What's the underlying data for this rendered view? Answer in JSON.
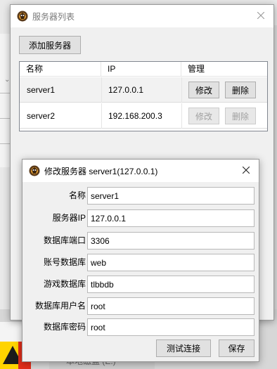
{
  "main_window": {
    "title": "服务器列表",
    "add_button": "添加服务器",
    "columns": [
      "名称",
      "IP",
      "管理"
    ],
    "rows": [
      {
        "name": "server1",
        "ip": "127.0.0.1",
        "edit": "修改",
        "delete": "删除",
        "enabled": true
      },
      {
        "name": "server2",
        "ip": "192.168.200.3",
        "edit": "修改",
        "delete": "删除",
        "enabled": false
      }
    ]
  },
  "edit_window": {
    "title": "修改服务器 server1(127.0.0.1)",
    "fields": [
      {
        "label": "名称",
        "value": "server1"
      },
      {
        "label": "服务器IP",
        "value": "127.0.0.1"
      },
      {
        "label": "数据库端口",
        "value": "3306"
      },
      {
        "label": "账号数据库",
        "value": "web"
      },
      {
        "label": "游戏数据库",
        "value": "tlbbdb"
      },
      {
        "label": "数据库用户名",
        "value": "root"
      },
      {
        "label": "数据库密码",
        "value": "root"
      }
    ],
    "test_button": "测试连接",
    "save_button": "保存"
  },
  "background": {
    "disk_label": "本地磁盘 (E:)"
  },
  "colors": {
    "window_bg": "#f0f0f0",
    "titlebar_bg": "#ffffff",
    "button_bg": "#e1e1e1",
    "disabled_text": "#a0a0a0"
  }
}
